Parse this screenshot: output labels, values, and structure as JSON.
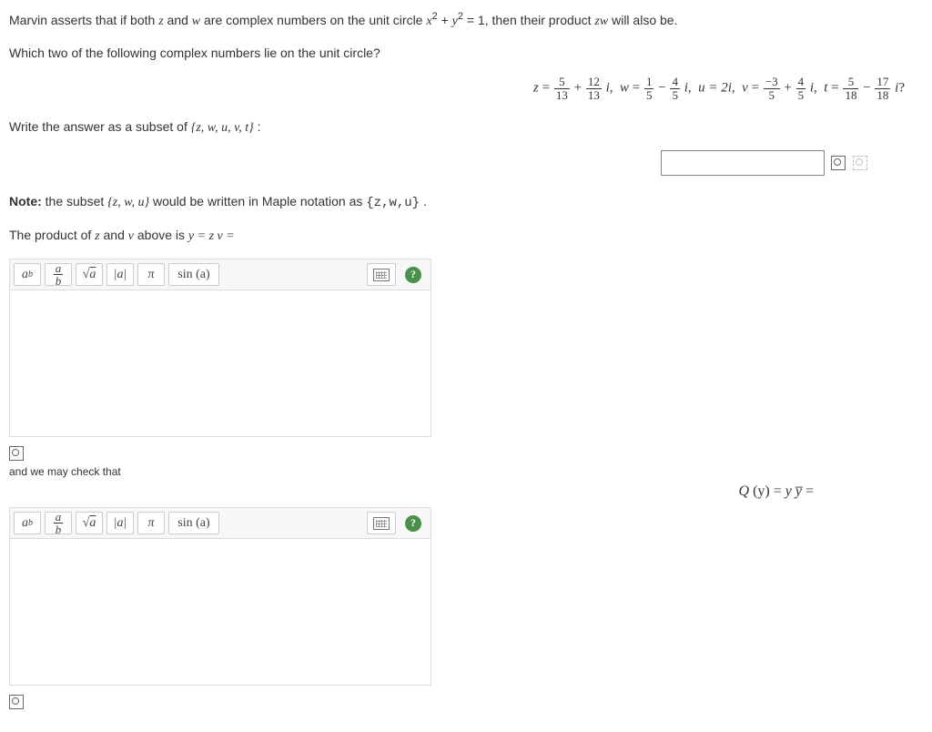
{
  "intro": {
    "prefix": "Marvin asserts that if both ",
    "z": "z",
    "and_w_txt": " and ",
    "w": "w",
    "mid": " are complex numbers on the unit circle ",
    "eq_lhs_x": "x",
    "eq_plus": " + ",
    "eq_lhs_y": "y",
    "eq_exp": "2",
    "eq_rhs": " = 1,",
    "tail": "  then their product ",
    "zw": "zw",
    "tail2": " will also be."
  },
  "q1": "Which two of the following complex numbers lie on the unit circle?",
  "values": {
    "z": {
      "a_num": "5",
      "a_den": "13",
      "b_num": "12",
      "b_den": "13"
    },
    "w": {
      "a_num": "1",
      "a_den": "5",
      "b_num": "4",
      "b_den": "5"
    },
    "u_text": "u = 2i",
    "v": {
      "a_num": "−3",
      "a_den": "5",
      "b_num": "4",
      "b_den": "5"
    },
    "t": {
      "a_num": "5",
      "a_den": "18",
      "b_num": "17",
      "b_den": "18"
    },
    "qmark": "?"
  },
  "subset_instr_pre": "Write the answer as a subset of ",
  "subset_set": "{z, w, u, v, t}",
  "subset_colon": " :",
  "note_label": "Note:",
  "note_pre": " the subset ",
  "note_set": "{z, w, u}",
  "note_mid": " would be written in Maple notation as ",
  "note_maple": "{z,w,u}",
  "note_dot": ".",
  "product_line_pre": "The product of ",
  "product_z": "z",
  "product_and": " and ",
  "product_v": "v",
  "product_line_post": " above is ",
  "product_eq": "y = z v =",
  "toolbar": {
    "pow": "a",
    "pow_sup": "b",
    "frac_a": "a",
    "frac_b": "b",
    "sqrt": "√",
    "sqrt_arg": "a",
    "abs": "|a|",
    "pi": "π",
    "sin": "sin (a)"
  },
  "check_text": "and we may check that",
  "qy": {
    "Q": "Q",
    "of_y": " (y) = ",
    "y": "y",
    "ybar": "y̅",
    "eq": " ="
  }
}
